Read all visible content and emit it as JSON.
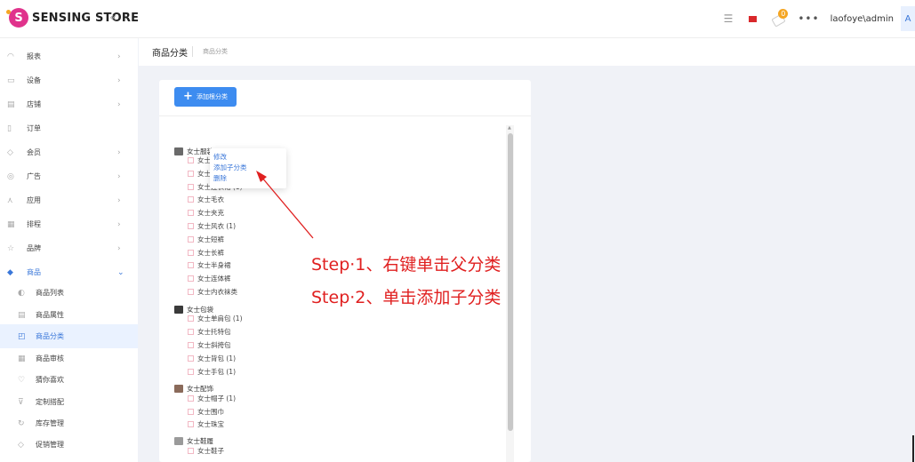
{
  "app": {
    "logo_letter": "S",
    "logo_text": "SENSING STORE",
    "collapse_glyph": "«"
  },
  "topbar": {
    "user": "laofoye\\admin",
    "avatar_letter": "A",
    "notification_count": "0",
    "more": "•••"
  },
  "sidebar": {
    "items": [
      {
        "label": "报表",
        "icon": "chart-icon",
        "has_arrow": true
      },
      {
        "label": "设备",
        "icon": "device-icon",
        "has_arrow": true
      },
      {
        "label": "店铺",
        "icon": "store-icon",
        "has_arrow": true
      },
      {
        "label": "订单",
        "icon": "order-icon",
        "has_arrow": false
      },
      {
        "label": "会员",
        "icon": "member-icon",
        "has_arrow": true
      },
      {
        "label": "广告",
        "icon": "ad-icon",
        "has_arrow": true
      },
      {
        "label": "应用",
        "icon": "app-icon",
        "has_arrow": true
      },
      {
        "label": "排程",
        "icon": "schedule-icon",
        "has_arrow": true
      },
      {
        "label": "品牌",
        "icon": "brand-icon",
        "has_arrow": true
      },
      {
        "label": "商品",
        "icon": "goods-icon",
        "has_arrow": true,
        "open": true
      }
    ],
    "sub_items": [
      {
        "label": "商品列表",
        "icon": "list-icon"
      },
      {
        "label": "商品属性",
        "icon": "attribute-icon"
      },
      {
        "label": "商品分类",
        "icon": "category-icon",
        "active": true
      },
      {
        "label": "商品审核",
        "icon": "audit-icon"
      },
      {
        "label": "猜你喜欢",
        "icon": "heart-icon"
      },
      {
        "label": "定制搭配",
        "icon": "match-icon"
      },
      {
        "label": "库存管理",
        "icon": "stock-icon"
      },
      {
        "label": "促销管理",
        "icon": "promo-icon"
      }
    ]
  },
  "breadcrumb": {
    "title": "商品分类",
    "crumb": "商品分类"
  },
  "main": {
    "add_root_button": "添加根分类",
    "tree": [
      {
        "label": "女士服装 (1)",
        "children": [
          "女士T恤",
          "女士衬衫",
          "女士连衣裙 (1)",
          "女士毛衣",
          "女士夹克",
          "女士风衣 (1)",
          "女士短裤",
          "女士长裤",
          "女士半身裙",
          "女士连体裤",
          "女士内衣袜类"
        ]
      },
      {
        "label": "女士包袋",
        "children": [
          "女士单肩包 (1)",
          "女士托特包",
          "女士斜挎包",
          "女士背包 (1)",
          "女士手包 (1)"
        ]
      },
      {
        "label": "女士配饰",
        "children": [
          "女士帽子 (1)",
          "女士围巾",
          "女士珠宝"
        ]
      },
      {
        "label": "女士鞋履",
        "children": [
          "女士鞋子"
        ]
      }
    ],
    "context_menu": [
      "修改",
      "添加子分类",
      "删除"
    ]
  },
  "annotations": {
    "step1": "Step·1、右键单击父分类",
    "step2": "Step·2、单击添加子分类",
    "color": "#e02020"
  },
  "colors": {
    "accent": "#3d8cf0",
    "brand": "#e0338c"
  }
}
